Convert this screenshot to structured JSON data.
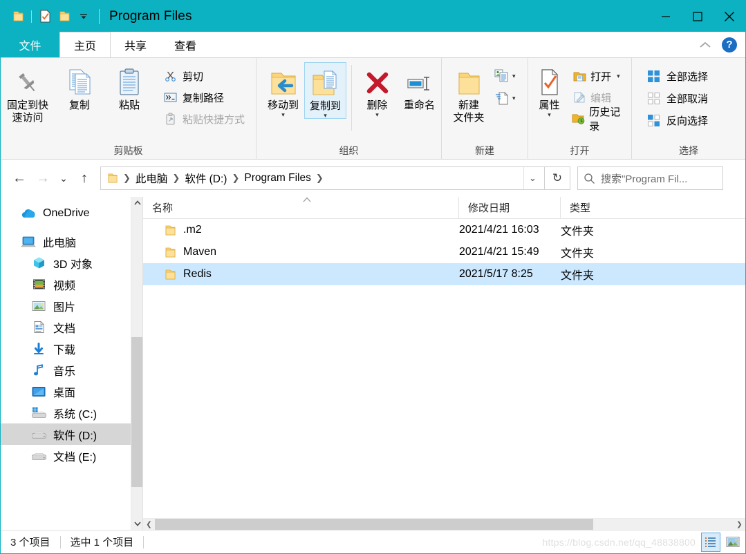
{
  "colors": {
    "title_bar": "#0CB2C1",
    "selection": "#CCE8FF",
    "nav_selection": "#D6D6D6",
    "ribbon_bg": "#F6F6F6",
    "accent_blue": "#1B6EC2",
    "folder_yellow": "#FBD57E"
  },
  "titlebar": {
    "title": "Program Files",
    "quick_access": [
      {
        "name": "folder-icon",
        "label": "属性"
      },
      {
        "name": "properties-icon",
        "label": "属性"
      },
      {
        "name": "new-folder-icon",
        "label": "新建文件夹"
      },
      {
        "name": "customize-chevron-icon",
        "label": "自定义快速访问工具栏"
      }
    ],
    "window_controls": [
      {
        "name": "minimize-button",
        "glyph": "—"
      },
      {
        "name": "maximize-button",
        "glyph": "□"
      },
      {
        "name": "close-button",
        "glyph": "✕"
      }
    ]
  },
  "tabs": [
    {
      "label": "文件",
      "kind": "file"
    },
    {
      "label": "主页",
      "kind": "active"
    },
    {
      "label": "共享",
      "kind": "normal"
    },
    {
      "label": "查看",
      "kind": "normal"
    }
  ],
  "tab_right": {
    "collapse_label": "折叠功能区",
    "help_label": "?"
  },
  "ribbon": {
    "groups": [
      {
        "name": "clipboard",
        "label": "剪贴板",
        "big_buttons": [
          {
            "label": "固定到快\n速访问",
            "icon": "pin-icon"
          },
          {
            "label": "复制",
            "icon": "copy-icon"
          },
          {
            "label": "粘贴",
            "icon": "paste-icon"
          }
        ],
        "small_buttons": [
          {
            "label": "剪切",
            "icon": "scissors-icon",
            "disabled": false
          },
          {
            "label": "复制路径",
            "icon": "copy-path-icon",
            "disabled": false
          },
          {
            "label": "粘贴快捷方式",
            "icon": "paste-shortcut-icon",
            "disabled": true
          }
        ]
      },
      {
        "name": "organize",
        "label": "组织",
        "big_buttons": [
          {
            "label": "移动到",
            "icon": "move-to-icon",
            "has_caret": true
          },
          {
            "label": "复制到",
            "icon": "copy-to-icon",
            "has_caret": true,
            "selected": true
          },
          {
            "label": "删除",
            "icon": "delete-x-icon",
            "has_caret": true
          },
          {
            "label": "重命名",
            "icon": "rename-icon",
            "has_caret": false
          }
        ]
      },
      {
        "name": "new",
        "label": "新建",
        "big_buttons": [
          {
            "label": "新建\n文件夹",
            "icon": "new-folder-icon"
          }
        ],
        "small_buttons": [
          {
            "label": "",
            "icon": "new-item-icon",
            "has_caret": true
          },
          {
            "label": "",
            "icon": "easy-access-icon",
            "has_caret": true
          }
        ]
      },
      {
        "name": "open",
        "label": "打开",
        "big_buttons": [
          {
            "label": "属性",
            "icon": "properties-icon",
            "has_caret": true
          }
        ],
        "small_buttons": [
          {
            "label": "打开",
            "icon": "open-folder-icon",
            "has_caret": true,
            "disabled": false
          },
          {
            "label": "编辑",
            "icon": "edit-icon",
            "disabled": true
          },
          {
            "label": "历史记录",
            "icon": "history-icon",
            "disabled": false
          }
        ]
      },
      {
        "name": "select",
        "label": "选择",
        "small_buttons": [
          {
            "label": "全部选择",
            "icon": "select-all-icon"
          },
          {
            "label": "全部取消",
            "icon": "select-none-icon"
          },
          {
            "label": "反向选择",
            "icon": "invert-selection-icon"
          }
        ]
      }
    ]
  },
  "address_bar": {
    "back": {
      "name": "back-button",
      "glyph": "←",
      "disabled": false
    },
    "forward": {
      "name": "forward-button",
      "glyph": "→",
      "disabled": true
    },
    "recent": {
      "name": "recent-locations-button",
      "glyph": "⌄"
    },
    "up": {
      "name": "up-button",
      "glyph": "↑"
    },
    "breadcrumbs": [
      {
        "label": "此电脑"
      },
      {
        "label": "软件 (D:)"
      },
      {
        "label": "Program Files"
      }
    ],
    "dropdown_glyph": "⌄",
    "refresh": {
      "name": "refresh-button",
      "glyph": "↻"
    }
  },
  "search": {
    "icon": "search-icon",
    "placeholder": "搜索\"Program Fil..."
  },
  "nav_pane": {
    "items": [
      {
        "label": "OneDrive",
        "icon": "onedrive-cloud-icon",
        "level": 0,
        "selected": false
      },
      {
        "label": "此电脑",
        "icon": "this-pc-icon",
        "level": 0,
        "selected": false,
        "gap_before": true
      },
      {
        "label": "3D 对象",
        "icon": "3d-objects-icon",
        "level": 1,
        "selected": false
      },
      {
        "label": "视频",
        "icon": "videos-icon",
        "level": 1,
        "selected": false
      },
      {
        "label": "图片",
        "icon": "pictures-icon",
        "level": 1,
        "selected": false
      },
      {
        "label": "文档",
        "icon": "documents-icon",
        "level": 1,
        "selected": false
      },
      {
        "label": "下载",
        "icon": "downloads-icon",
        "level": 1,
        "selected": false
      },
      {
        "label": "音乐",
        "icon": "music-icon",
        "level": 1,
        "selected": false
      },
      {
        "label": "桌面",
        "icon": "desktop-icon",
        "level": 1,
        "selected": false
      },
      {
        "label": "系统 (C:)",
        "icon": "system-drive-icon",
        "level": 1,
        "selected": false
      },
      {
        "label": "软件 (D:)",
        "icon": "drive-icon",
        "level": 1,
        "selected": true
      },
      {
        "label": "文档 (E:)",
        "icon": "drive-icon",
        "level": 1,
        "selected": false
      }
    ],
    "scroll_up_glyph": "⌃",
    "scroll_down_glyph": "⌄"
  },
  "file_list": {
    "columns": [
      {
        "key": "name",
        "label": "名称",
        "sorted": true,
        "sort_dir": "asc"
      },
      {
        "key": "date",
        "label": "修改日期"
      },
      {
        "key": "type",
        "label": "类型"
      }
    ],
    "rows": [
      {
        "name": ".m2",
        "date": "2021/4/21 16:03",
        "type": "文件夹",
        "icon": "folder-icon",
        "selected": false
      },
      {
        "name": "Maven",
        "date": "2021/4/21 15:49",
        "type": "文件夹",
        "icon": "folder-icon",
        "selected": false
      },
      {
        "name": "Redis",
        "date": "2021/5/17 8:25",
        "type": "文件夹",
        "icon": "folder-icon",
        "selected": true
      }
    ],
    "hscroll": {
      "left_glyph": "❮",
      "right_glyph": "❯"
    }
  },
  "status_bar": {
    "item_count": "3 个项目",
    "selection_info": "选中 1 个项目",
    "watermark": "https://blog.csdn.net/qq_48838800",
    "view_buttons": [
      {
        "name": "details-view-button",
        "label": "详细信息",
        "active": true
      },
      {
        "name": "large-icons-view-button",
        "label": "大图标",
        "active": false
      }
    ]
  }
}
